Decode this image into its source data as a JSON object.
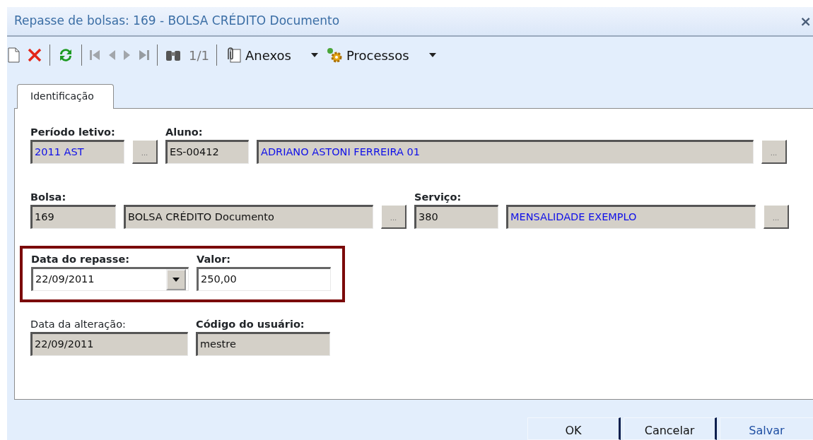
{
  "window": {
    "title": "Repasse de bolsas: 169 - BOLSA CRÉDITO Documento",
    "close": "×"
  },
  "toolbar": [
    {
      "kind": "new",
      "disabled": false
    },
    {
      "kind": "delete",
      "disabled": false
    },
    {
      "kind": "separator"
    },
    {
      "kind": "refresh",
      "disabled": false
    },
    {
      "kind": "separator"
    },
    {
      "kind": "first",
      "disabled": true
    },
    {
      "kind": "prev",
      "disabled": true
    },
    {
      "kind": "next",
      "disabled": true
    },
    {
      "kind": "last",
      "disabled": true
    },
    {
      "kind": "separator"
    },
    {
      "kind": "find",
      "disabled": false
    },
    {
      "kind": "counter",
      "label": "1/1",
      "disabled": true
    },
    {
      "kind": "separator"
    },
    {
      "kind": "attachments",
      "label": "Anexos",
      "disabled": false
    },
    {
      "kind": "processes",
      "label": "Processos",
      "disabled": false
    }
  ],
  "tabs": [
    {
      "label": "Identificação",
      "selected": true
    }
  ],
  "form_rows": [
    {
      "highlighted": false,
      "groups": [
        {
          "label": "Período letivo:",
          "bold": true,
          "inputs": [
            {
              "value": "2011 AST",
              "readonly": true,
              "linked": true,
              "kind": "text"
            }
          ],
          "lookup": "..."
        },
        {
          "label": "Aluno:",
          "bold": true,
          "inputs": [
            {
              "value": "ES-00412",
              "readonly": true,
              "linked": false,
              "kind": "text"
            },
            {
              "value": "ADRIANO ASTONI FERREIRA 01",
              "readonly": true,
              "linked": true,
              "kind": "text"
            }
          ],
          "lookup": "..."
        }
      ]
    },
    {
      "highlighted": false,
      "groups": [
        {
          "label": "Bolsa:",
          "bold": true,
          "inputs": [
            {
              "value": "169",
              "readonly": true,
              "linked": false,
              "kind": "text"
            },
            {
              "value": "BOLSA CRÉDITO Documento",
              "readonly": true,
              "linked": false,
              "kind": "text"
            }
          ],
          "lookup": "..."
        },
        {
          "label": "Serviço:",
          "bold": true,
          "inputs": [
            {
              "value": "380",
              "readonly": true,
              "linked": false,
              "kind": "text"
            },
            {
              "value": "MENSALIDADE EXEMPLO",
              "readonly": true,
              "linked": true,
              "kind": "text"
            }
          ],
          "lookup": "..."
        }
      ]
    },
    {
      "highlighted": true,
      "groups": [
        {
          "label": "Data do repasse:",
          "bold": true,
          "inputs": [
            {
              "value": "22/09/2011",
              "readonly": false,
              "linked": false,
              "kind": "date"
            }
          ]
        },
        {
          "label": "Valor:",
          "bold": true,
          "inputs": [
            {
              "value": "250,00",
              "readonly": false,
              "linked": false,
              "kind": "text"
            }
          ]
        }
      ]
    },
    {
      "highlighted": false,
      "groups": [
        {
          "label": "Data da alteração:",
          "bold": false,
          "inputs": [
            {
              "value": "22/09/2011",
              "readonly": true,
              "linked": false,
              "kind": "text"
            }
          ]
        },
        {
          "label": "Código do usuário:",
          "bold": true,
          "inputs": [
            {
              "value": "mestre",
              "readonly": true,
              "linked": false,
              "kind": "text"
            }
          ]
        }
      ]
    }
  ],
  "buttons": [
    {
      "label": "OK",
      "primary": false
    },
    {
      "label": "Cancelar",
      "primary": false
    },
    {
      "label": "Salvar",
      "primary": true
    }
  ]
}
